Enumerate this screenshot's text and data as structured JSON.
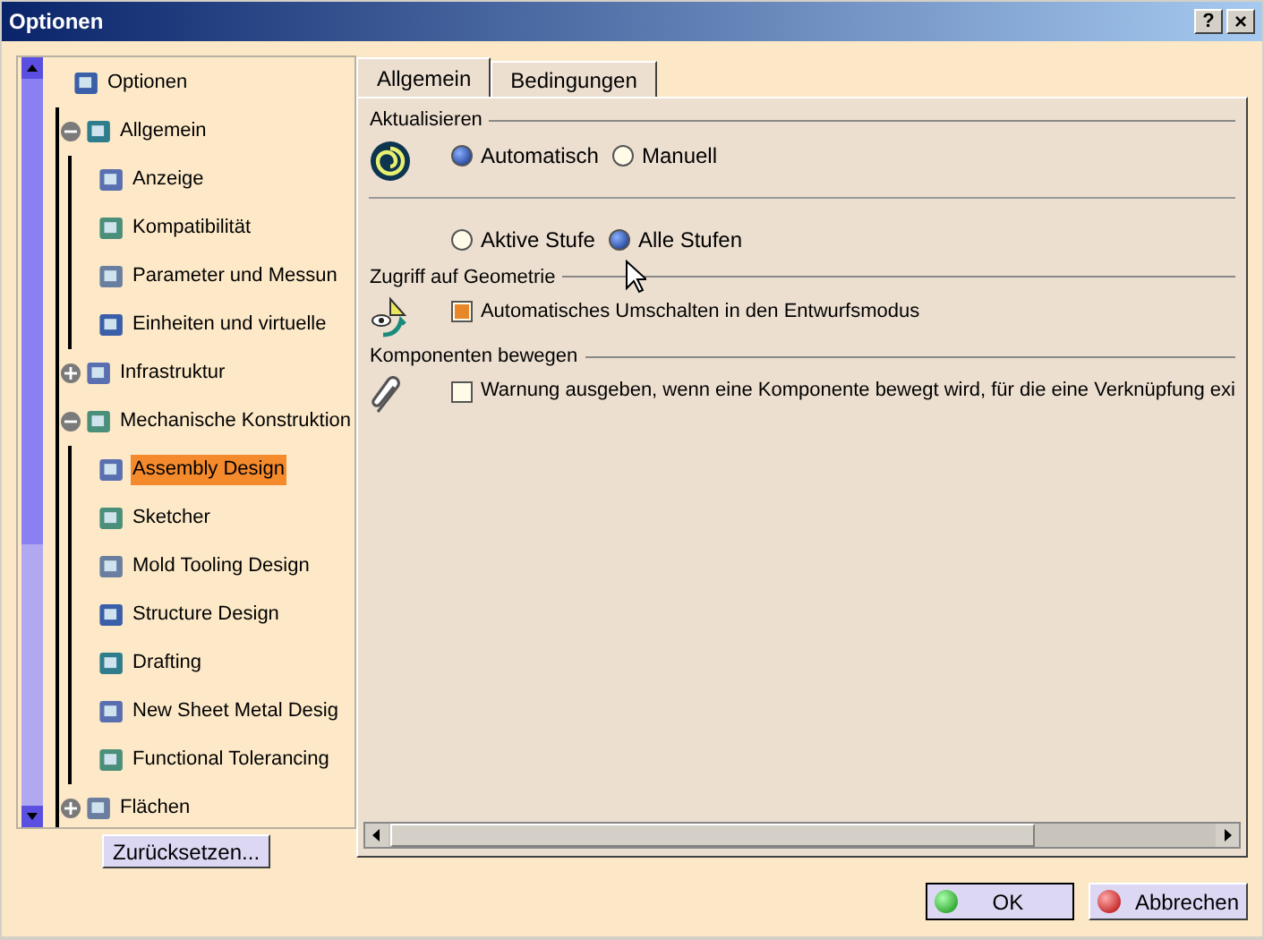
{
  "window": {
    "title": "Optionen",
    "help_button": "?",
    "close_button": "×"
  },
  "tree": {
    "items": [
      {
        "label": "Optionen",
        "selected": false,
        "children": [
          {
            "label": "Allgemein",
            "expanded": true,
            "selected": false,
            "children": [
              {
                "label": "Anzeige",
                "selected": false
              },
              {
                "label": "Kompatibilität",
                "selected": false
              },
              {
                "label": "Parameter und Messun",
                "selected": false
              },
              {
                "label": "Einheiten und virtuelle",
                "selected": false
              }
            ]
          },
          {
            "label": "Infrastruktur",
            "expanded": false,
            "selected": false
          },
          {
            "label": "Mechanische Konstruktion",
            "expanded": true,
            "selected": false,
            "children": [
              {
                "label": "Assembly Design",
                "selected": true
              },
              {
                "label": "Sketcher",
                "selected": false
              },
              {
                "label": "Mold Tooling Design",
                "selected": false
              },
              {
                "label": "Structure Design",
                "selected": false
              },
              {
                "label": "Drafting",
                "selected": false
              },
              {
                "label": "New Sheet Metal Desig",
                "selected": false
              },
              {
                "label": "Functional Tolerancing",
                "selected": false
              }
            ]
          },
          {
            "label": "Flächen",
            "expanded": false,
            "selected": false
          }
        ]
      }
    ]
  },
  "reset_button": "Zurücksetzen...",
  "tabs": [
    {
      "label": "Allgemein",
      "selected": true
    },
    {
      "label": "Bedingungen",
      "selected": false
    }
  ],
  "sections": [
    {
      "title": "Aktualisieren",
      "rows": [
        {
          "kind": "radio",
          "options": [
            {
              "label": "Automatisch",
              "selected": true
            },
            {
              "label": "Manuell",
              "selected": false
            }
          ]
        },
        {
          "kind": "separator"
        },
        {
          "kind": "radio",
          "options": [
            {
              "label": "Aktive Stufe",
              "selected": false
            },
            {
              "label": "Alle Stufen",
              "selected": true
            }
          ]
        }
      ]
    },
    {
      "title": "Zugriff auf Geometrie",
      "rows": [
        {
          "kind": "checkbox",
          "label": "Automatisches Umschalten in den Entwurfsmodus",
          "checked": true
        }
      ]
    },
    {
      "title": "Komponenten bewegen",
      "rows": [
        {
          "kind": "checkbox",
          "label": "Warnung ausgeben, wenn eine Komponente bewegt wird, für die eine Verknüpfung exi",
          "checked": false
        }
      ]
    }
  ],
  "buttons": [
    {
      "label": "OK",
      "kind": "ok"
    },
    {
      "label": "Abbrechen",
      "kind": "cancel"
    }
  ]
}
